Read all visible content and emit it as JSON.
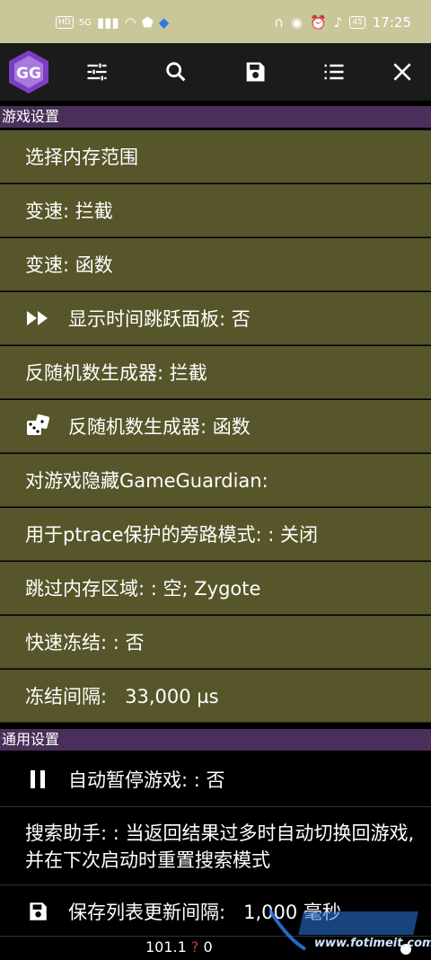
{
  "status_bar": {
    "hd_label": "HD",
    "signal_label": "5G",
    "battery": "45",
    "time": "17:25"
  },
  "toolbar": {
    "logo_text": "GG",
    "icons": [
      "sliders-icon",
      "search-icon",
      "save-icon",
      "list-icon",
      "close-icon"
    ]
  },
  "sections": {
    "game_settings_header": "游戏设置",
    "general_settings_header": "通用设置"
  },
  "game_items": [
    {
      "label": "选择内存范围"
    },
    {
      "label": "变速: 拦截"
    },
    {
      "label": "变速: 函数"
    },
    {
      "label": "显示时间跳跃面板: 否",
      "icon": "fast-forward-icon"
    },
    {
      "label": "反随机数生成器: 拦截"
    },
    {
      "label": "反随机数生成器: 函数",
      "icon": "dice-icon"
    },
    {
      "label": "对游戏隐藏GameGuardian:"
    },
    {
      "label": "用于ptrace保护的旁路模式: : 关闭"
    },
    {
      "label": "跳过内存区域: : 空; Zygote"
    },
    {
      "label": "快速冻结: : 否"
    },
    {
      "label": "冻结间隔:   33,000 µs"
    }
  ],
  "general_items": [
    {
      "label": "自动暂停游戏: : 否",
      "icon": "pause-icon"
    },
    {
      "label": "搜索助手: : 当返回结果过多时自动切换回游戏, 并在下次启动时重置搜索模式"
    },
    {
      "label": "保存列表更新间隔:   1,000 毫秒",
      "icon": "save-icon"
    }
  ],
  "bottom": {
    "stat_value": "101.1",
    "stat_marker": "?",
    "stat_count": "0",
    "watermark_site": "www.fotimeit.com"
  },
  "colors": {
    "row_bg": "#57552a",
    "header_bg": "#4a2f5a",
    "accent": "#7a3fc0"
  }
}
